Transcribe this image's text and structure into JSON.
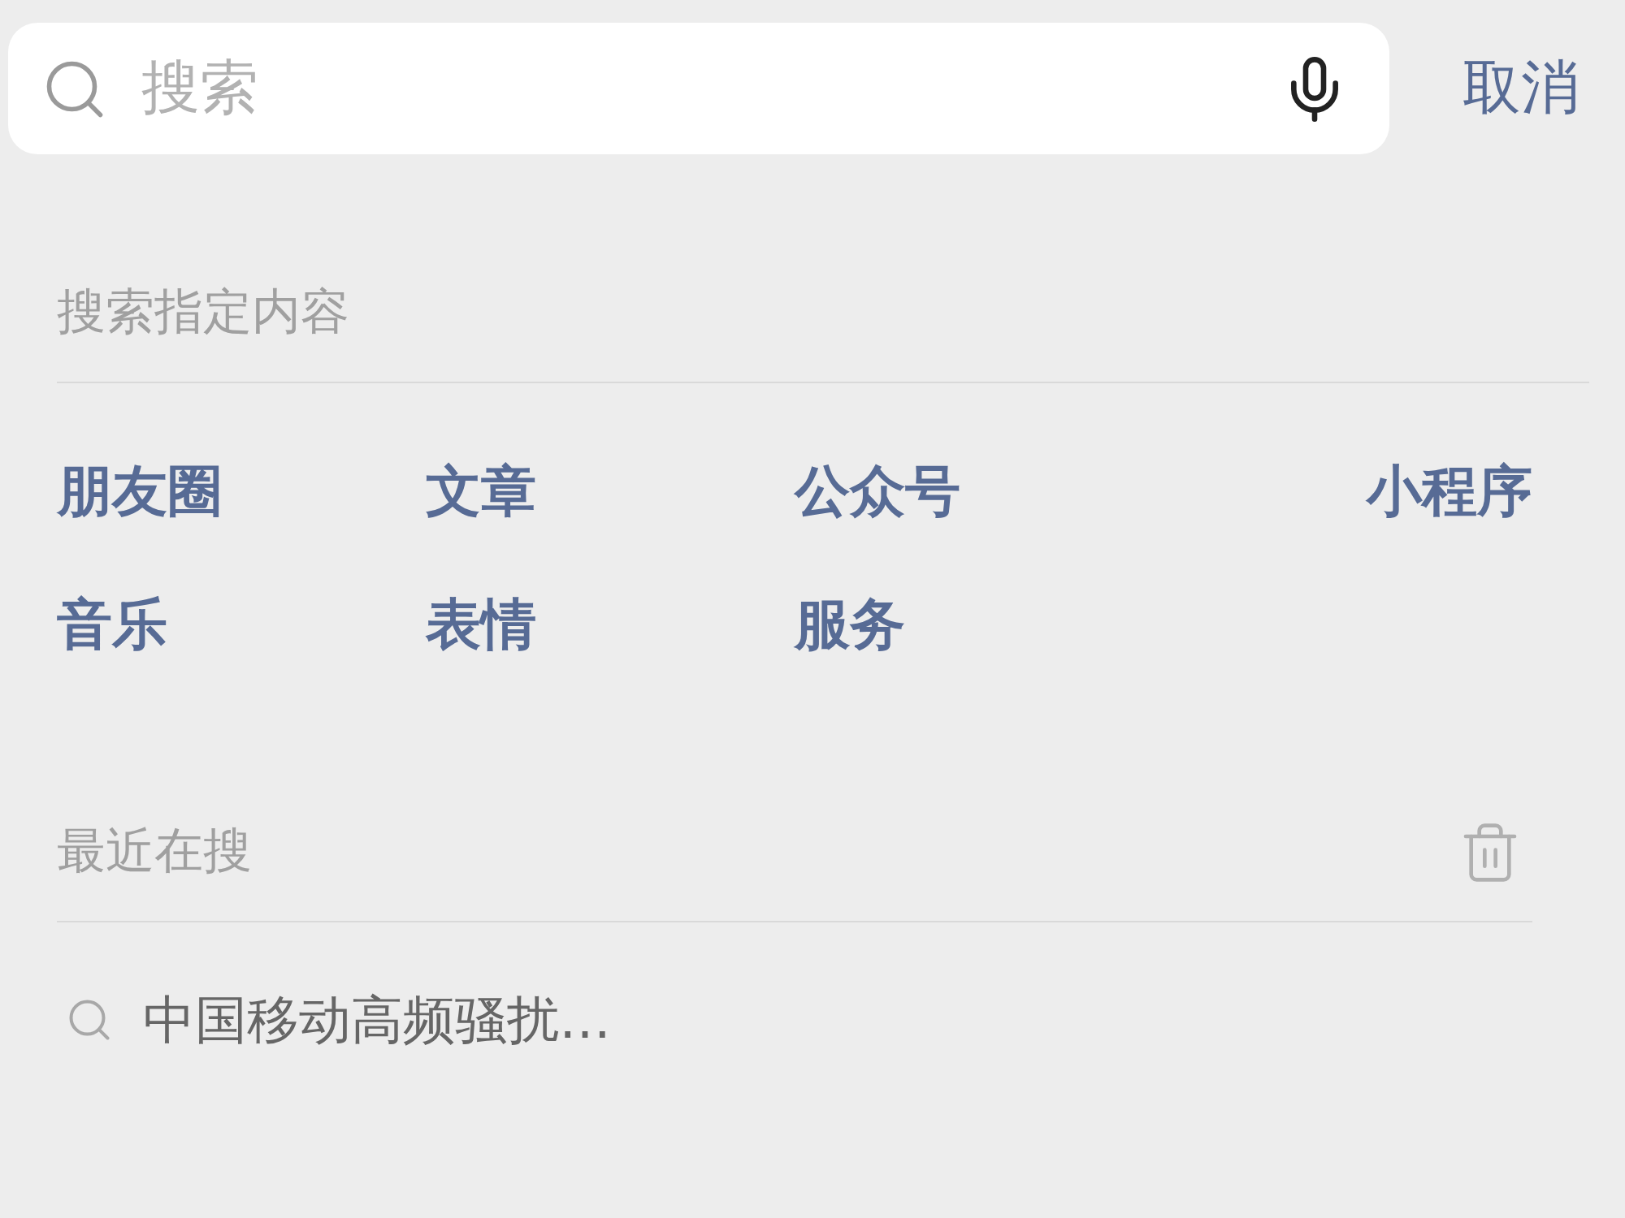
{
  "search": {
    "placeholder": "搜索",
    "cancel": "取消"
  },
  "specified": {
    "title": "搜索指定内容",
    "items": [
      "朋友圈",
      "文章",
      "公众号",
      "小程序",
      "音乐",
      "表情",
      "服务"
    ]
  },
  "recent": {
    "title": "最近在搜",
    "items": [
      "中国移动高频骚扰…"
    ]
  }
}
